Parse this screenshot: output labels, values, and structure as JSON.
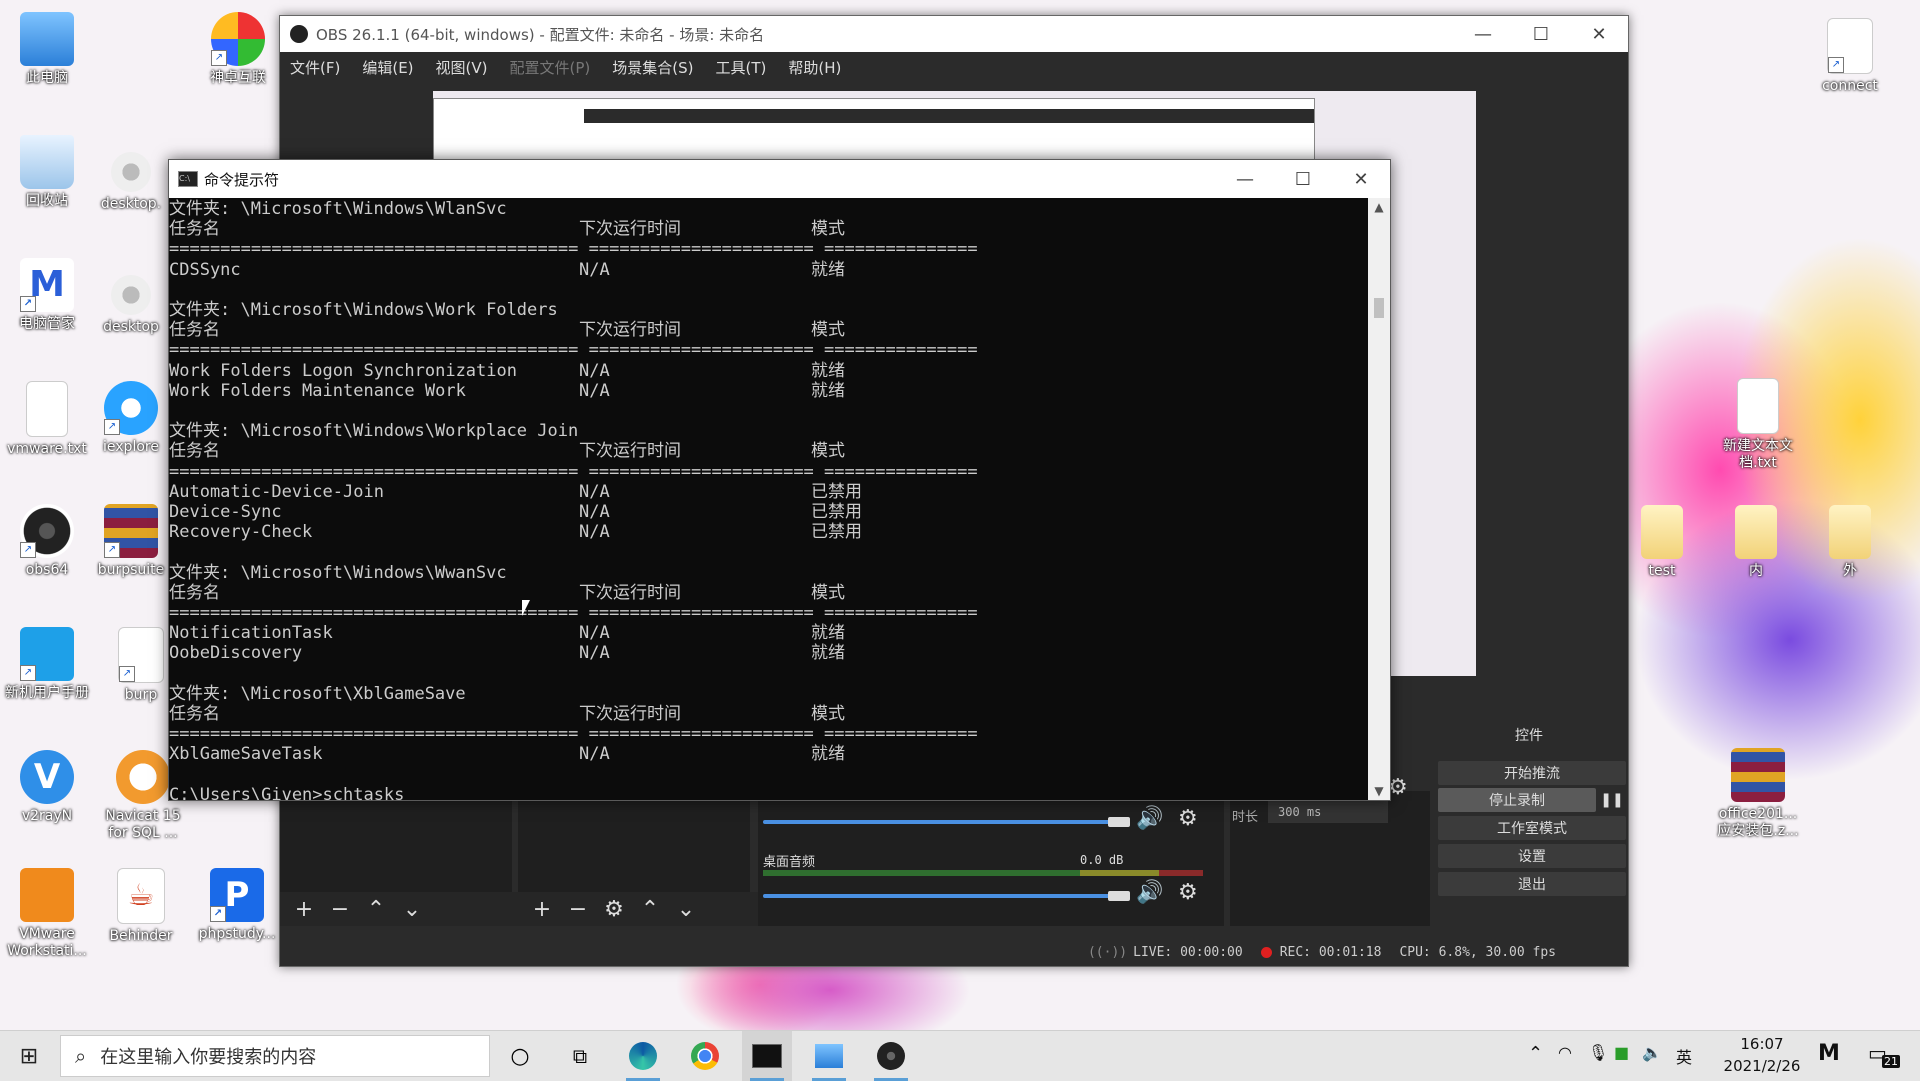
{
  "desktop": {
    "icons": [
      {
        "label": "此电脑"
      },
      {
        "label": "神卓互联"
      },
      {
        "label": "回收站"
      },
      {
        "label": "desktop."
      },
      {
        "label": "电脑管家"
      },
      {
        "label": "desktop"
      },
      {
        "label": "vmware.txt"
      },
      {
        "label": "iexplore"
      },
      {
        "label": "obs64"
      },
      {
        "label": "burpsuite"
      },
      {
        "label": "新机用户手册"
      },
      {
        "label": "burp"
      },
      {
        "label": "v2rayN"
      },
      {
        "label": "Navicat 15 for SQL ..."
      },
      {
        "label": "VMware Workstati..."
      },
      {
        "label": "Behinder"
      },
      {
        "label": "phpstudy..."
      },
      {
        "label": "connect"
      },
      {
        "label": "新建文本文档.txt"
      },
      {
        "label": "test"
      },
      {
        "label": "内"
      },
      {
        "label": "外"
      },
      {
        "label": "office201... 应安装包.z..."
      }
    ]
  },
  "obs": {
    "title": "OBS 26.1.1 (64-bit, windows) - 配置文件: 未命名 - 场景: 未命名",
    "menu": [
      "文件(F)",
      "编辑(E)",
      "视图(V)",
      "配置文件(P)",
      "场景集合(S)",
      "工具(T)",
      "帮助(H)"
    ],
    "mixer": {
      "desktop_audio_label": "桌面音频",
      "db_value": "0.0 dB"
    },
    "transition": {
      "duration_label": "时长",
      "duration_value": "300 ms"
    },
    "controls": {
      "title": "控件",
      "buttons": [
        "开始推流",
        "停止录制",
        "工作室模式",
        "设置",
        "退出"
      ]
    },
    "status": {
      "live": "LIVE: 00:00:00",
      "rec": "REC: 00:01:18",
      "cpu": "CPU: 6.8%, 30.00 fps"
    },
    "colors": {
      "rec": "#e02020",
      "accent": "#4a90e2"
    }
  },
  "cmd": {
    "title": "命令提示符",
    "lines": [
      {
        "t": "folder",
        "text": "文件夹: \\Microsoft\\Windows\\WlanSvc"
      },
      {
        "t": "header",
        "c1": "任务名",
        "c2": "下次运行时间",
        "c3": "模式"
      },
      {
        "t": "sep",
        "text": "======================================== ====================== ==============="
      },
      {
        "t": "row",
        "c1": "CDSSync",
        "c2": "N/A",
        "c3": "就绪"
      },
      {
        "t": "blank"
      },
      {
        "t": "folder",
        "text": "文件夹: \\Microsoft\\Windows\\Work Folders"
      },
      {
        "t": "header",
        "c1": "任务名",
        "c2": "下次运行时间",
        "c3": "模式"
      },
      {
        "t": "sep",
        "text": "======================================== ====================== ==============="
      },
      {
        "t": "row",
        "c1": "Work Folders Logon Synchronization",
        "c2": "N/A",
        "c3": "就绪"
      },
      {
        "t": "row",
        "c1": "Work Folders Maintenance Work",
        "c2": "N/A",
        "c3": "就绪"
      },
      {
        "t": "blank"
      },
      {
        "t": "folder",
        "text": "文件夹: \\Microsoft\\Windows\\Workplace Join"
      },
      {
        "t": "header",
        "c1": "任务名",
        "c2": "下次运行时间",
        "c3": "模式"
      },
      {
        "t": "sep",
        "text": "======================================== ====================== ==============="
      },
      {
        "t": "row",
        "c1": "Automatic-Device-Join",
        "c2": "N/A",
        "c3": "已禁用"
      },
      {
        "t": "row",
        "c1": "Device-Sync",
        "c2": "N/A",
        "c3": "已禁用"
      },
      {
        "t": "row",
        "c1": "Recovery-Check",
        "c2": "N/A",
        "c3": "已禁用"
      },
      {
        "t": "blank"
      },
      {
        "t": "folder",
        "text": "文件夹: \\Microsoft\\Windows\\WwanSvc"
      },
      {
        "t": "header",
        "c1": "任务名",
        "c2": "下次运行时间",
        "c3": "模式"
      },
      {
        "t": "sep",
        "text": "======================================== ====================== ==============="
      },
      {
        "t": "row",
        "c1": "NotificationTask",
        "c2": "N/A",
        "c3": "就绪"
      },
      {
        "t": "row",
        "c1": "OobeDiscovery",
        "c2": "N/A",
        "c3": "就绪"
      },
      {
        "t": "blank"
      },
      {
        "t": "folder",
        "text": "文件夹: \\Microsoft\\XblGameSave"
      },
      {
        "t": "header",
        "c1": "任务名",
        "c2": "下次运行时间",
        "c3": "模式"
      },
      {
        "t": "sep",
        "text": "======================================== ====================== ==============="
      },
      {
        "t": "row",
        "c1": "XblGameSaveTask",
        "c2": "N/A",
        "c3": "就绪"
      },
      {
        "t": "blank"
      },
      {
        "t": "prompt",
        "text": "C:\\Users\\Given>schtasks"
      }
    ]
  },
  "taskbar": {
    "search_placeholder": "在这里输入你要搜索的内容",
    "ime": "英",
    "time": "16:07",
    "date": "2021/2/26",
    "notification_count": "21"
  }
}
